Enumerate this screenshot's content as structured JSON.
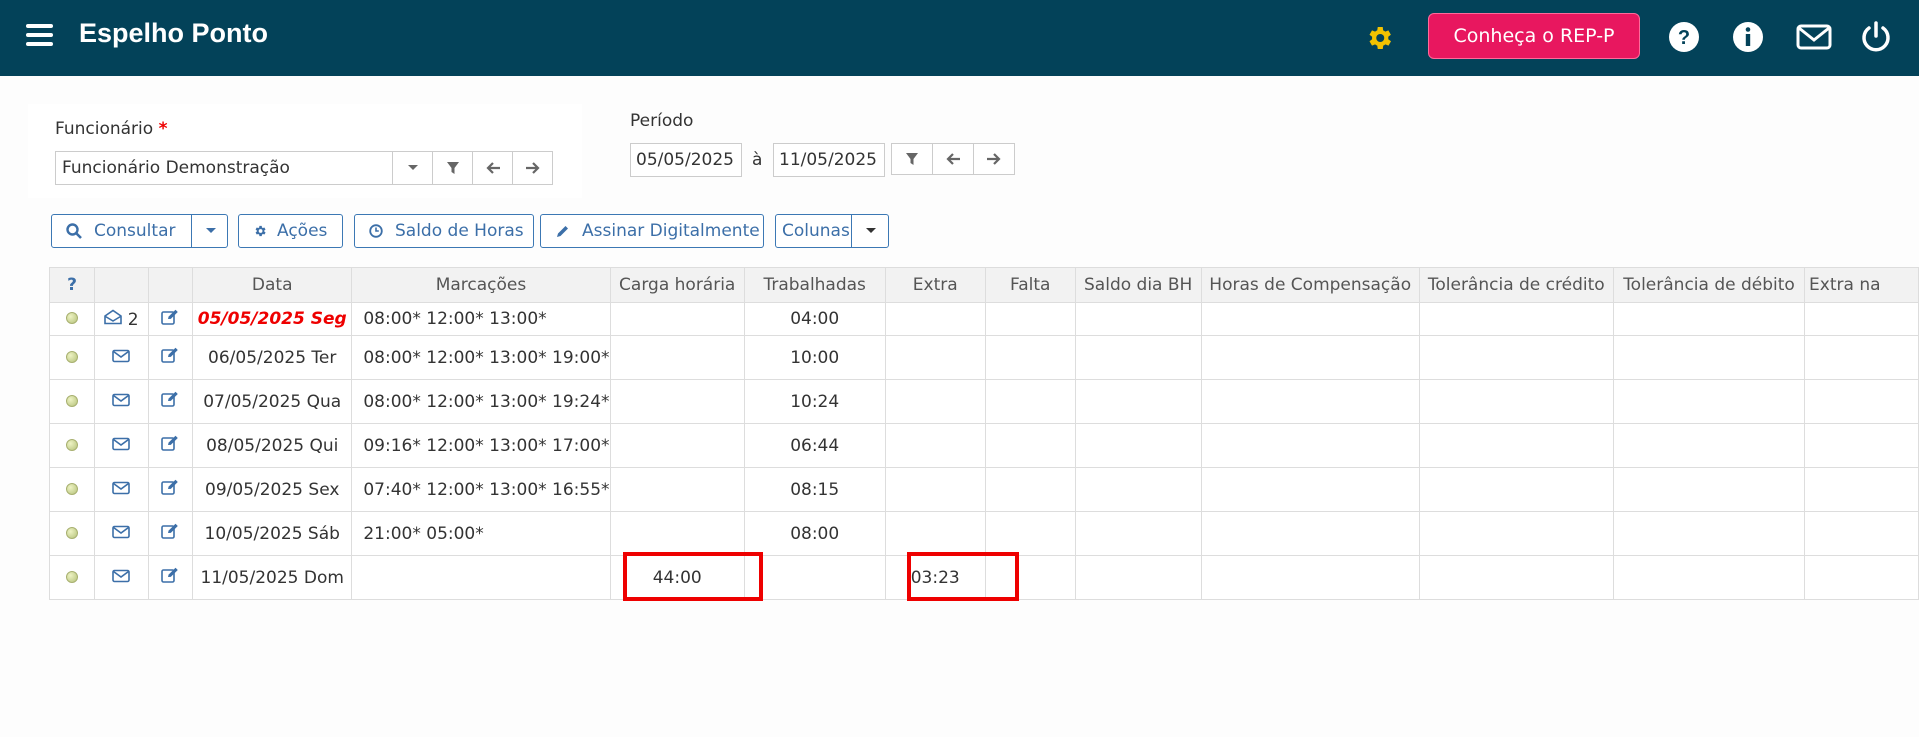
{
  "header": {
    "title": "Espelho Ponto",
    "promo_button": "Conheça o REP-P",
    "colors": {
      "bar": "#034259",
      "promo": "#e8175f",
      "gear": "#f2c200"
    }
  },
  "filters": {
    "employee_label": "Funcionário",
    "required_mark": "*",
    "employee_value": "Funcionário Demonstração",
    "period_label": "Período",
    "date_from": "05/05/2025",
    "date_sep": "à",
    "date_to": "11/05/2025"
  },
  "toolbar": {
    "consult": "Consultar",
    "actions": "Ações",
    "hours_balance": "Saldo de Horas",
    "sign": "Assinar Digitalmente",
    "columns": "Colunas"
  },
  "table": {
    "help": "?",
    "columns": [
      "Data",
      "Marcações",
      "Carga horária",
      "Trabalhadas",
      "Extra",
      "Falta",
      "Saldo dia BH",
      "Horas de Compensação",
      "Tolerância de crédito",
      "Tolerância de débito",
      "Extra na"
    ],
    "rows": [
      {
        "msg_count": "2",
        "date": "05/05/2025 Seg",
        "marks": "08:00* 12:00* 13:00*",
        "carga": "",
        "worked": "04:00",
        "extra": ""
      },
      {
        "msg_count": "",
        "date": "06/05/2025 Ter",
        "marks": "08:00* 12:00* 13:00* 19:00*",
        "carga": "",
        "worked": "10:00",
        "extra": ""
      },
      {
        "msg_count": "",
        "date": "07/05/2025 Qua",
        "marks": "08:00* 12:00* 13:00* 19:24*",
        "carga": "",
        "worked": "10:24",
        "extra": ""
      },
      {
        "msg_count": "",
        "date": "08/05/2025 Qui",
        "marks": "09:16* 12:00* 13:00* 17:00*",
        "carga": "",
        "worked": "06:44",
        "extra": ""
      },
      {
        "msg_count": "",
        "date": "09/05/2025 Sex",
        "marks": "07:40* 12:00* 13:00* 16:55*",
        "carga": "",
        "worked": "08:15",
        "extra": ""
      },
      {
        "msg_count": "",
        "date": "10/05/2025 Sáb",
        "marks": "21:00* 05:00*",
        "carga": "",
        "worked": "08:00",
        "extra": ""
      },
      {
        "msg_count": "",
        "date": "11/05/2025 Dom",
        "marks": "",
        "carga": "44:00",
        "worked": "",
        "extra": "03:23"
      }
    ]
  }
}
